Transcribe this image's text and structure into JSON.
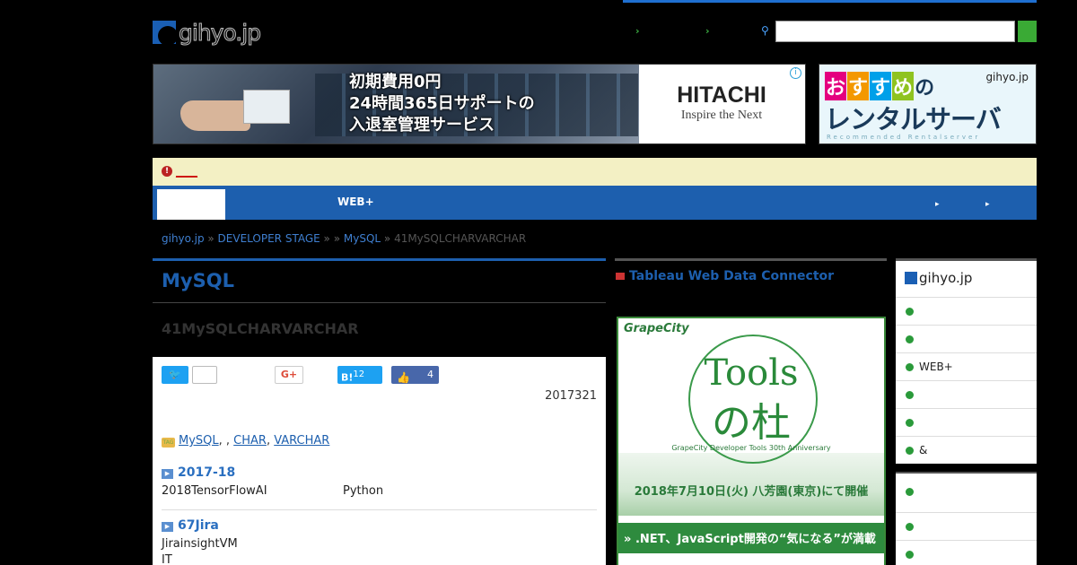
{
  "header": {
    "logo_text": "gihyo.jp",
    "links": [
      "",
      ""
    ],
    "search": {
      "placeholder": "",
      "value": ""
    }
  },
  "banner_left": {
    "copy_lines": [
      "初期費用0円",
      "24時間365日サポートの",
      "入退室管理サービス"
    ],
    "brand_name": "HITACHI",
    "brand_tag": "Inspire the Next"
  },
  "banner_right": {
    "chips": [
      "お",
      "す",
      "す",
      "め"
    ],
    "chip_tail": "の",
    "headline": "レンタルサーバ",
    "logo": "gihyo.jp",
    "sub": "Recommended Rentalserver",
    "chip_colors": [
      "#e4007f",
      "#f39800",
      "#00a0e9",
      "#8fc31f"
    ]
  },
  "notice": {
    "text": "____"
  },
  "nav": {
    "items": [
      "",
      "",
      "WEB+",
      ""
    ],
    "right": [
      "",
      ""
    ]
  },
  "breadcrumb": {
    "items": [
      "gihyo.jp",
      "DEVELOPER STAGE",
      "",
      "MySQL"
    ],
    "current": "41MySQLCHARVARCHAR"
  },
  "article": {
    "series_title": "MySQL",
    "title": "41MySQLCHARVARCHAR",
    "share": {
      "tweet_label": "",
      "tweet_count": "",
      "gplus_label": "G+",
      "hatena_label": "B!",
      "hatena_count": "12",
      "fb_count": "4"
    },
    "date": "2017321",
    "tags_label": "TAG",
    "tags": [
      "MySQL",
      "",
      "CHAR",
      "VARCHAR"
    ],
    "related": [
      {
        "title": "2017-18",
        "desc": "2018TensorFlowAI",
        "desc2": "Python"
      },
      {
        "title": "67Jira",
        "desc": "JirainsightVM",
        "desc2": "",
        "desc3": "IT"
      }
    ]
  },
  "middle": {
    "title": "Tableau Web Data Connector",
    "ad": {
      "brand": "GrapeCity",
      "headline_en": "Tools",
      "headline_jp": "の杜",
      "anniv": "GrapeCity Developer Tools 30th Anniversary",
      "event": "2018年7月10日(火) 八芳園(東京)にて開催",
      "band": ".NET、JavaScript開発の“気になる”が満載",
      "band2": ""
    }
  },
  "sidebar": {
    "logo": "gihyo.jp",
    "items": [
      "",
      "",
      "WEB+",
      "",
      "",
      "&"
    ],
    "box2_heading": "",
    "box2_items": [
      "",
      ""
    ]
  },
  "colors": {
    "accent": "#1d5fae",
    "green": "#3aaa35",
    "notice_bg": "#f3f0c4"
  }
}
